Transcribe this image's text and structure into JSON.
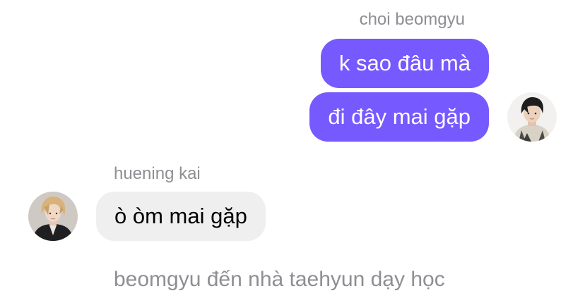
{
  "chat": {
    "messages": [
      {
        "sender": "choi beomgyu",
        "side": "outgoing",
        "bubbles": [
          "k sao đâu mà",
          "đi đây mai gặp"
        ],
        "avatar": "profile-photo"
      },
      {
        "sender": "huening kai",
        "side": "incoming",
        "bubbles": [
          "ò òm mai gặp"
        ],
        "avatar": "profile-photo"
      }
    ],
    "system_note": "beomgyu đến nhà taehyun dạy học"
  },
  "colors": {
    "outgoing_bubble": "#7659ff",
    "incoming_bubble": "#efefef",
    "sender_name": "#8e8e93",
    "background": "#ffffff"
  }
}
